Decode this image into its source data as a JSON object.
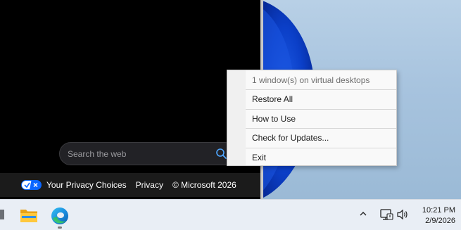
{
  "browser": {
    "search": {
      "placeholder": "Search the web"
    },
    "footer": {
      "privacy_choices": "Your Privacy Choices",
      "privacy": "Privacy",
      "copyright": "© Microsoft 2026"
    }
  },
  "context_menu": {
    "header": "1 window(s) on virtual desktops",
    "items": [
      "Restore All",
      "How to Use",
      "Check for Updates...",
      "Exit"
    ]
  },
  "taskbar": {
    "apps": [
      {
        "name": "file-explorer-icon"
      },
      {
        "name": "edge-icon",
        "active": true
      }
    ],
    "tray": {
      "icons": [
        "show-hidden-icons-chevron",
        "network-icon",
        "volume-icon"
      ]
    },
    "clock": {
      "time": "10:21 PM",
      "date": "2/9/2026"
    }
  },
  "colors": {
    "accent_blue": "#0a3fc4",
    "browser_bg": "#000000",
    "taskbar_bg": "#e9eef5"
  }
}
